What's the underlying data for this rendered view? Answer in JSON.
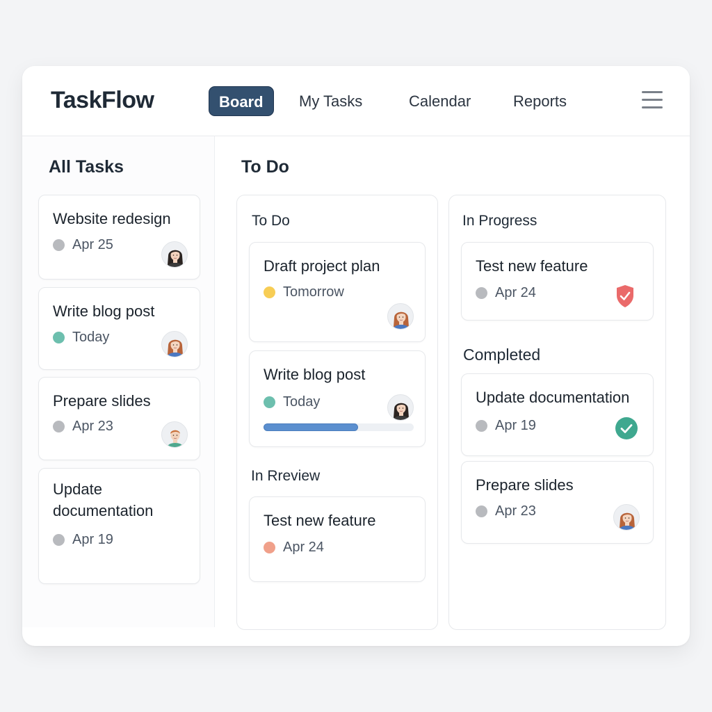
{
  "app": {
    "title": "TaskFlow"
  },
  "nav": {
    "tabs": [
      {
        "label": "Board",
        "active": true
      },
      {
        "label": "My Tasks",
        "active": false
      },
      {
        "label": "Calendar",
        "active": false
      },
      {
        "label": "Reports",
        "active": false
      }
    ],
    "menu_icon": "hamburger-menu-icon"
  },
  "sidebar": {
    "title": "All Tasks",
    "cards": [
      {
        "title": "Website redesign",
        "date": "Apr 25",
        "status_color": "#b8babe",
        "avatar": "woman-dark-hair"
      },
      {
        "title": "Write blog post",
        "date": "Today",
        "status_color": "#6dbfae",
        "avatar": "woman-auburn-hair"
      },
      {
        "title": "Prepare slides",
        "date": "Apr 23",
        "status_color": "#b8babe",
        "avatar": "man-ginger-hair"
      },
      {
        "title_line1": "Update",
        "title_line2": "documentation",
        "date": "Apr 19",
        "status_color": "#b8babe"
      }
    ]
  },
  "board": {
    "title": "To Do",
    "todo_column": {
      "label": "To Do",
      "cards": [
        {
          "title": "Draft project plan",
          "date": "Tomorrow",
          "status_color": "#f7cd55",
          "avatar": "woman-auburn-hair"
        },
        {
          "title": "Write blog post",
          "date": "Today",
          "status_color": "#6dbfae",
          "avatar": "woman-dark-hair",
          "progress": 0.63
        }
      ]
    },
    "review_section": {
      "label": "In  Rreview",
      "cards": [
        {
          "title": "Test new feature",
          "date": "Apr 24",
          "status_color": "#f0a08a"
        }
      ]
    },
    "in_progress_column": {
      "label": "In Progress",
      "cards": [
        {
          "title": "Test new feature",
          "date": "Apr 24",
          "status_color": "#b8babe",
          "icon": "shield-check-icon"
        }
      ]
    },
    "completed_section": {
      "label": "Completed",
      "cards": [
        {
          "title": "Update documentation",
          "date": "Apr 19",
          "status_color": "#b8babe",
          "icon": "check-circle-icon"
        },
        {
          "title": "Prepare slides",
          "date": "Apr 23",
          "status_color": "#b8babe",
          "avatar": "woman-auburn-hair"
        }
      ]
    }
  },
  "colors": {
    "accent": "#33506f",
    "progress": "#5b8fcf",
    "shield": "#ea6a6a",
    "check": "#3fa88f"
  }
}
